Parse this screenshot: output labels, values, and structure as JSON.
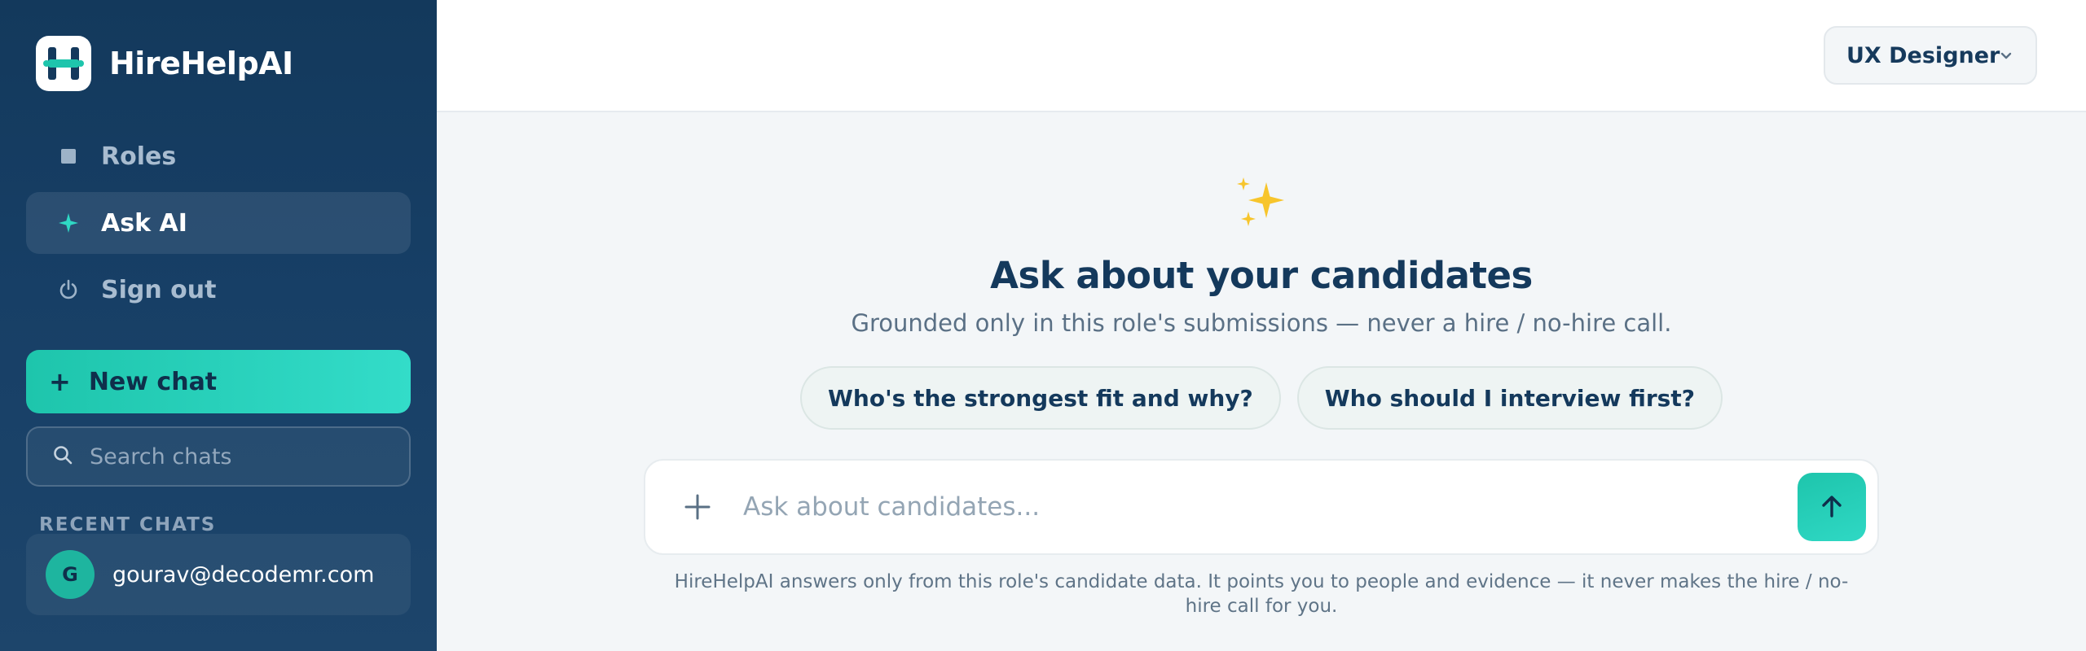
{
  "brand": {
    "name": "HireHelpAI"
  },
  "nav": [
    {
      "label": "Roles",
      "icon": "square-icon"
    },
    {
      "label": "Ask AI",
      "icon": "sparkle-icon",
      "active": true
    },
    {
      "label": "Sign out",
      "icon": "power-icon"
    }
  ],
  "sidebar": {
    "new_chat_label": "New chat",
    "search_placeholder": "Search chats",
    "recent_title": "RECENT CHATS",
    "user": {
      "initial": "G",
      "email": "gourav@decodemr.com"
    }
  },
  "topbar": {
    "role_selected": "UX Designer"
  },
  "hero": {
    "title": "Ask about your candidates",
    "subtitle": "Grounded only in this role's submissions — never a hire / no-hire call."
  },
  "suggestions": [
    "Who's the strongest fit and why?",
    "Who should I interview first?"
  ],
  "composer": {
    "placeholder": "Ask about candidates..."
  },
  "disclaimer": "HireHelpAI answers only from this role's candidate data. It points you to people and evidence — it never makes the hire / no-hire call for you.",
  "colors": {
    "sidebar_bg": "#173f66",
    "accent": "#1ec5ac",
    "title_text": "#14395c"
  }
}
